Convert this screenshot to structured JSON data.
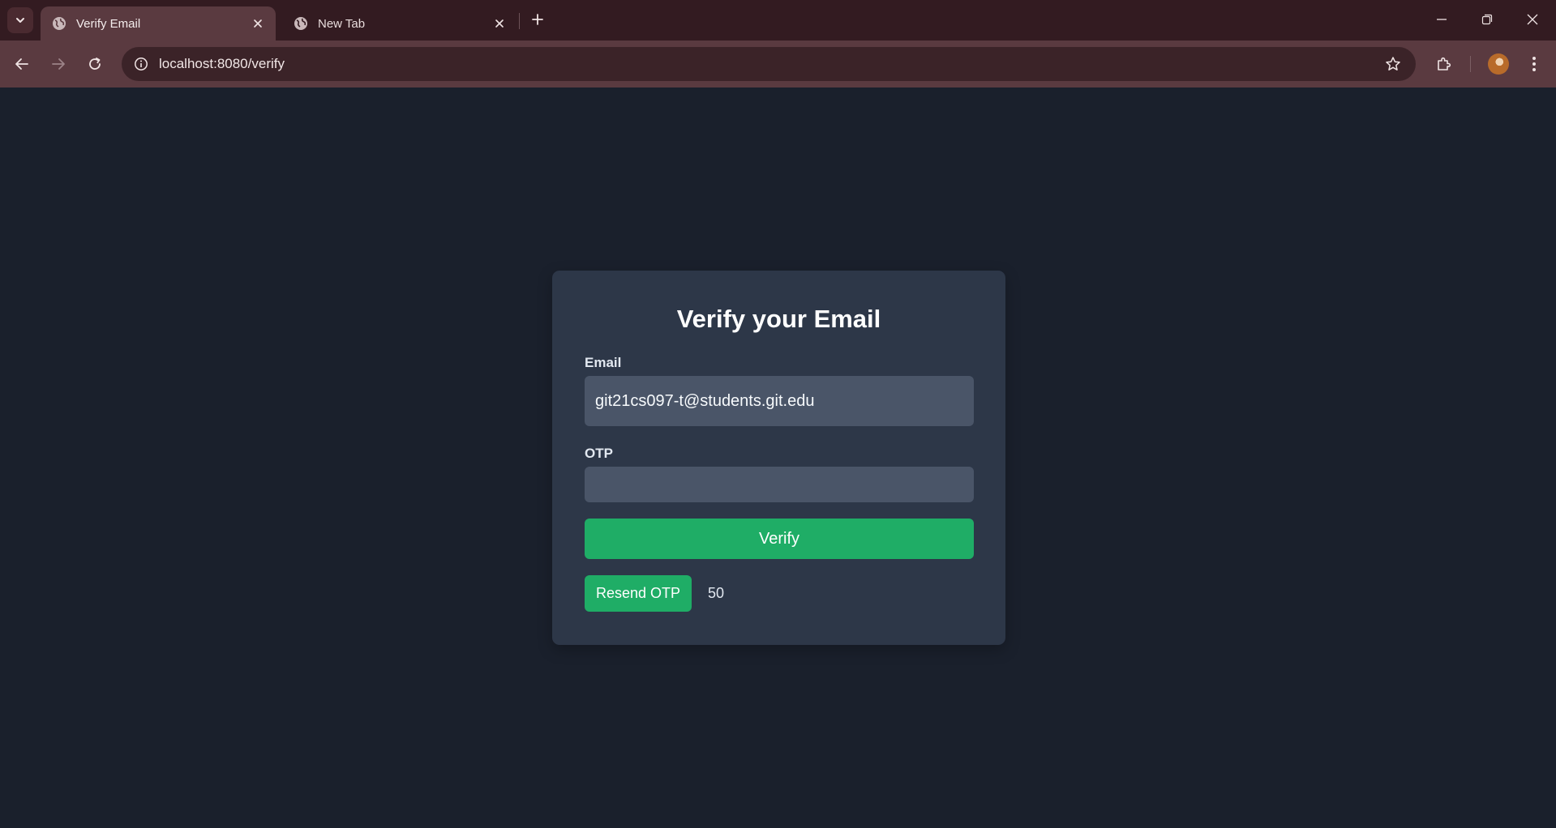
{
  "browser": {
    "tabs": [
      {
        "title": "Verify Email",
        "active": true,
        "icon": "globe-icon"
      },
      {
        "title": "New Tab",
        "active": false,
        "icon": "globe-icon"
      }
    ],
    "address": "localhost:8080/verify",
    "colors": {
      "tabbar": "#331b21",
      "toolbar": "#5a3a40",
      "omnibox": "#3b2328"
    }
  },
  "page": {
    "title": "Verify your Email",
    "email": {
      "label": "Email",
      "value": "git21cs097-t@students.git.edu"
    },
    "otp": {
      "label": "OTP",
      "value": ""
    },
    "verify_label": "Verify",
    "resend_label": "Resend OTP",
    "countdown": "50",
    "colors": {
      "background": "#1a202c",
      "card": "#2d3748",
      "input": "#4a5568",
      "accent": "#1fad66"
    }
  }
}
